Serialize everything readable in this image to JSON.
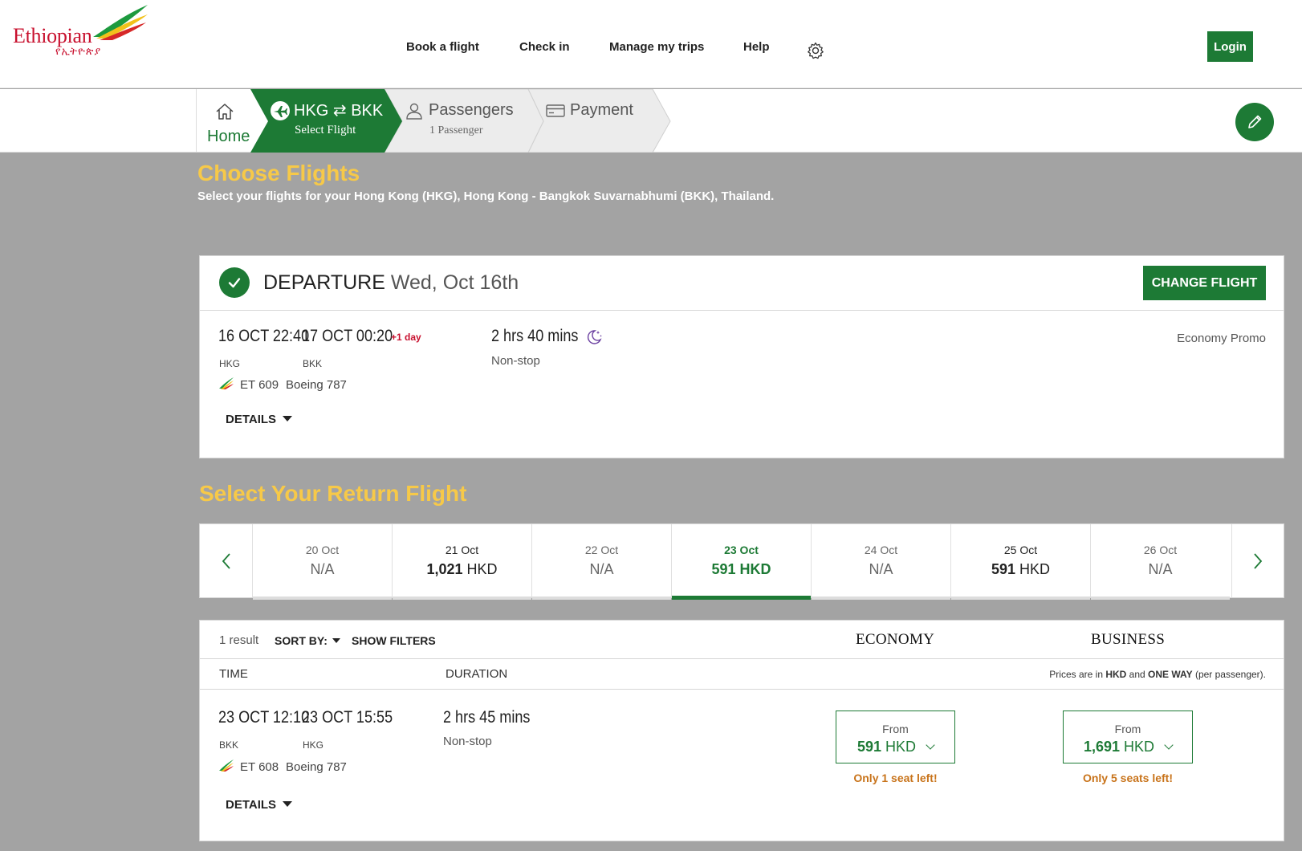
{
  "header": {
    "logo_text": "Ethiopian",
    "logo_sub": "የኢትዮጵያ",
    "nav": [
      "Book a flight",
      "Check in",
      "Manage my trips",
      "Help"
    ],
    "login_label": "Login"
  },
  "breadcrumb": {
    "home_label": "Home",
    "route_label": "HKG ⇄ BKK",
    "route_step": "Select Flight",
    "passengers_label": "Passengers",
    "passengers_sub": "1 Passenger",
    "payment_label": "Payment"
  },
  "page": {
    "title": "Choose Flights",
    "subtitle": "Select your flights for your Hong Kong (HKG), Hong Kong - Bangkok Suvarnabhumi (BKK), Thailand.",
    "return_title": "Select Your Return Flight"
  },
  "departure": {
    "label": "DEPARTURE",
    "date": "Wed, Oct 16th",
    "change_label": "CHANGE FLIGHT",
    "dep_time": "16 OCT 22:40",
    "arr_time": "17 OCT 00:20",
    "plus_day": "+1 day",
    "dep_code": "HKG",
    "arr_code": "BKK",
    "flight_no": "ET 609",
    "aircraft": "Boeing 787",
    "duration": "2 hrs 40 mins",
    "stops": "Non-stop",
    "fare_class": "Economy Promo",
    "details_label": "DETAILS"
  },
  "date_strip": [
    {
      "date": "20 Oct",
      "amount": "",
      "currency": "N/A"
    },
    {
      "date": "21 Oct",
      "amount": "1,021",
      "currency": "HKD"
    },
    {
      "date": "22 Oct",
      "amount": "",
      "currency": "N/A"
    },
    {
      "date": "23 Oct",
      "amount": "591",
      "currency": "HKD"
    },
    {
      "date": "24 Oct",
      "amount": "",
      "currency": "N/A"
    },
    {
      "date": "25 Oct",
      "amount": "591",
      "currency": "HKD"
    },
    {
      "date": "26 Oct",
      "amount": "",
      "currency": "N/A"
    }
  ],
  "results": {
    "count": "1 result",
    "sort_label": "SORT BY:",
    "filters_label": "SHOW FILTERS",
    "cabins": [
      "ECONOMY",
      "BUSINESS"
    ],
    "col_time": "TIME",
    "col_duration": "DURATION",
    "price_note": {
      "prefix": "Prices are in ",
      "currency": "HKD",
      "mid": " and ",
      "trip": "ONE WAY",
      "suffix": " (per passenger)."
    },
    "flight": {
      "dep_time": "23 OCT 12:10",
      "arr_time": "23 OCT 15:55",
      "dep_code": "BKK",
      "arr_code": "HKG",
      "flight_no": "ET 608",
      "aircraft": "Boeing 787",
      "duration": "2 hrs 45 mins",
      "stops": "Non-stop",
      "details_label": "DETAILS",
      "economy": {
        "from": "From",
        "amount": "591",
        "currency": "HKD",
        "seats": "Only 1 seat left!"
      },
      "business": {
        "from": "From",
        "amount": "1,691",
        "currency": "HKD",
        "seats": "Only 5 seats left!"
      }
    }
  },
  "colors": {
    "brand_green": "#1d7a35",
    "brand_red": "#c8102e",
    "title_yellow": "#f7c948",
    "seat_warning": "#c8731a"
  }
}
